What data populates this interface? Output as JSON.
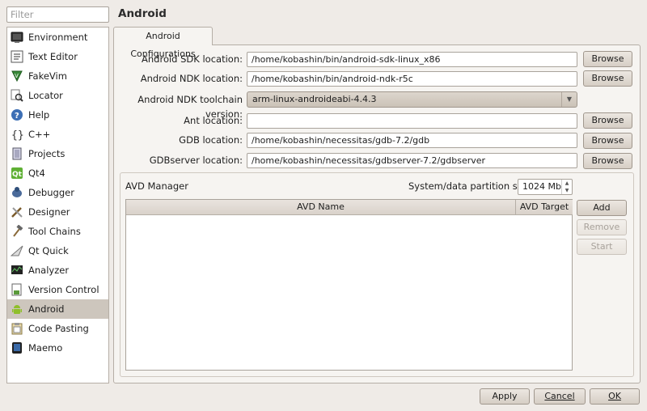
{
  "filter": {
    "placeholder": "Filter"
  },
  "sidebar": {
    "items": [
      {
        "label": "Environment",
        "icon": "monitor-icon"
      },
      {
        "label": "Text Editor",
        "icon": "text-editor-icon"
      },
      {
        "label": "FakeVim",
        "icon": "fakevim-icon"
      },
      {
        "label": "Locator",
        "icon": "locator-icon"
      },
      {
        "label": "Help",
        "icon": "help-icon"
      },
      {
        "label": "C++",
        "icon": "cpp-icon"
      },
      {
        "label": "Projects",
        "icon": "projects-icon"
      },
      {
        "label": "Qt4",
        "icon": "qt-icon"
      },
      {
        "label": "Debugger",
        "icon": "debugger-icon"
      },
      {
        "label": "Designer",
        "icon": "designer-icon"
      },
      {
        "label": "Tool Chains",
        "icon": "hammer-icon"
      },
      {
        "label": "Qt Quick",
        "icon": "qt-quick-icon"
      },
      {
        "label": "Analyzer",
        "icon": "analyzer-icon"
      },
      {
        "label": "Version Control",
        "icon": "version-control-icon"
      },
      {
        "label": "Android",
        "icon": "android-icon"
      },
      {
        "label": "Code Pasting",
        "icon": "code-pasting-icon"
      },
      {
        "label": "Maemo",
        "icon": "maemo-icon"
      }
    ],
    "selected": "Android"
  },
  "header": {
    "title": "Android"
  },
  "tabs": [
    {
      "label": "Android Configurations"
    }
  ],
  "form": {
    "sdk": {
      "label": "Android SDK location:",
      "value": "/home/kobashin/bin/android-sdk-linux_x86"
    },
    "ndk": {
      "label": "Android NDK location:",
      "value": "/home/kobashin/bin/android-ndk-r5c"
    },
    "toolchain": {
      "label": "Android NDK toolchain version:",
      "value": "arm-linux-androideabi-4.4.3"
    },
    "ant": {
      "label": "Ant location:",
      "value": ""
    },
    "gdb": {
      "label": "GDB location:",
      "value": "/home/kobashin/necessitas/gdb-7.2/gdb"
    },
    "gdbserver": {
      "label": "GDBserver location:",
      "value": "/home/kobashin/necessitas/gdbserver-7.2/gdbserver"
    },
    "browse_label": "Browse"
  },
  "avd": {
    "title": "AVD Manager",
    "partition_label": "System/data partition size:",
    "partition_value": "1024 Mb",
    "columns": [
      "AVD Name",
      "AVD Target"
    ],
    "rows": [],
    "add_label": "Add",
    "remove_label": "Remove",
    "start_label": "Start"
  },
  "footer": {
    "apply_label": "Apply",
    "cancel_label": "Cancel",
    "ok_label": "OK"
  }
}
